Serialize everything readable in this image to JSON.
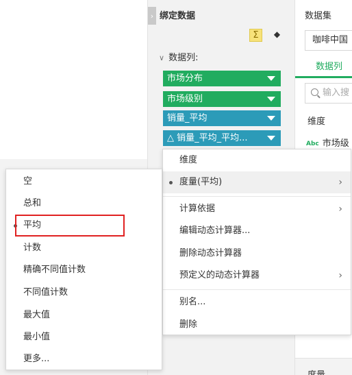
{
  "bind_panel": {
    "collapse_glyph": "›",
    "title": "绑定数据",
    "sigma_glyph": "Σ",
    "eraser_glyph": "◆",
    "columns_header": "数据列:",
    "chevron": "∨",
    "fields": [
      {
        "label": "市场分布",
        "color": "#21ac5f"
      },
      {
        "label": "市场级别",
        "color": "#21ac5f"
      },
      {
        "label": "销量_平均",
        "color": "#2c9bb8"
      },
      {
        "label": "销量_平均_平均...",
        "color": "#2c9bb8",
        "icon": "delta-icon"
      }
    ],
    "delta_glyph": "△"
  },
  "dataset_panel": {
    "title": "数据集",
    "dataset_value": "咖啡中国",
    "tab_label": "数据列",
    "search_placeholder": "输入搜",
    "dimension_header": "维度",
    "abc_badge": "Abc",
    "field_label": "市场级",
    "measure_header": "度量"
  },
  "context_menu": {
    "items": [
      {
        "label": "维度",
        "bullet": false,
        "submenu": false
      },
      {
        "label": "度量(平均)",
        "bullet": true,
        "submenu": true,
        "hover": true
      },
      {
        "label": "计算依据",
        "bullet": false,
        "submenu": true
      },
      {
        "label": "编辑动态计算器...",
        "bullet": false,
        "submenu": false
      },
      {
        "label": "删除动态计算器",
        "bullet": false,
        "submenu": false
      },
      {
        "label": "预定义的动态计算器",
        "bullet": false,
        "submenu": true
      },
      {
        "label": "别名...",
        "bullet": false,
        "submenu": false
      },
      {
        "label": "删除",
        "bullet": false,
        "submenu": false
      }
    ],
    "arrow_glyph": "›"
  },
  "aggregate_submenu": {
    "items": [
      {
        "label": "空",
        "selected": false
      },
      {
        "label": "总和",
        "selected": false
      },
      {
        "label": "平均",
        "selected": true
      },
      {
        "label": "计数",
        "selected": false
      },
      {
        "label": "精确不同值计数",
        "selected": false
      },
      {
        "label": "不同值计数",
        "selected": false
      },
      {
        "label": "最大值",
        "selected": false
      },
      {
        "label": "最小值",
        "selected": false
      },
      {
        "label": "更多...",
        "selected": false
      }
    ]
  }
}
